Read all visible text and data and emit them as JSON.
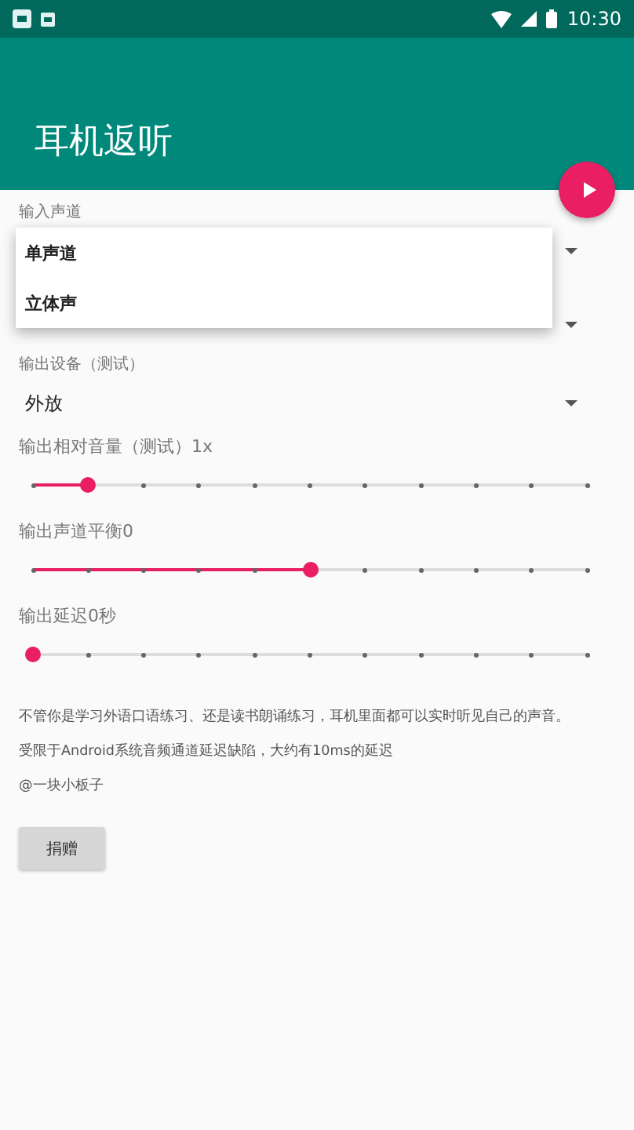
{
  "status_bar": {
    "time": "10:30"
  },
  "app_bar": {
    "title": "耳机返听"
  },
  "fields": [
    {
      "kind": "spinner",
      "label": "输入声道"
    },
    {
      "kind": "spinner"
    },
    {
      "kind": "spinner",
      "label": "输出设备（测试）",
      "value": "外放"
    },
    {
      "kind": "slider",
      "label": "输出相对音量（测试）1x",
      "level": 0.1
    },
    {
      "kind": "slider",
      "label": "输出声道平衡0",
      "level": 0.5
    },
    {
      "kind": "slider",
      "label": "输出延迟0秒",
      "level": 0
    }
  ],
  "paragraphs": [
    "不管你是学习外语口语练习、还是读书朗诵练习，耳机里面都可以实时听见自己的声音。",
    "受限于Android系统音频通道延迟缺陷，大约有10ms的延迟",
    "@一块小板子"
  ],
  "button": "捐赠",
  "menu": {
    "items": [
      {
        "label": "单声道"
      },
      {
        "label": "立体声"
      }
    ]
  }
}
